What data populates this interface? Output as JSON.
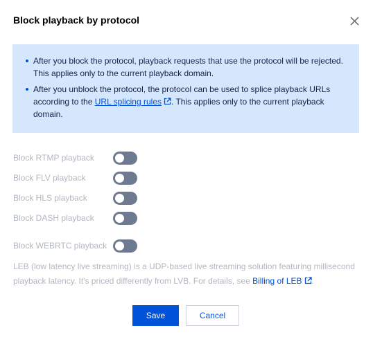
{
  "dialog": {
    "title": "Block playback by protocol"
  },
  "notice": {
    "item1": "After you block the protocol, playback requests that use the protocol will be rejected. This applies only to the current playback domain.",
    "item2_before": "After you unblock the protocol, the protocol can be used to splice playback URLs according to the ",
    "item2_link": "URL splicing rules",
    "item2_after": ". This applies only to the current playback domain."
  },
  "toggles": [
    {
      "label": "Block RTMP playback",
      "enabled": false
    },
    {
      "label": "Block FLV playback",
      "enabled": false
    },
    {
      "label": "Block HLS playback",
      "enabled": false
    },
    {
      "label": "Block DASH playback",
      "enabled": false
    },
    {
      "label": "Block WEBRTC playback",
      "enabled": false
    }
  ],
  "billing": {
    "text": "LEB (low latency live streaming) is a UDP-based live streaming solution featuring millisecond playback latency. It's priced differently from LVB. For details, see ",
    "link": "Billing of LEB",
    "after": "."
  },
  "buttons": {
    "save": "Save",
    "cancel": "Cancel"
  },
  "colors": {
    "accent": "#0052d9",
    "notice_bg": "#d5e7fd",
    "toggle_off": "#6e7a90",
    "disabled_text": "#b2b7c0"
  },
  "icons": {
    "close": "close-icon",
    "external": "external-link-icon"
  }
}
